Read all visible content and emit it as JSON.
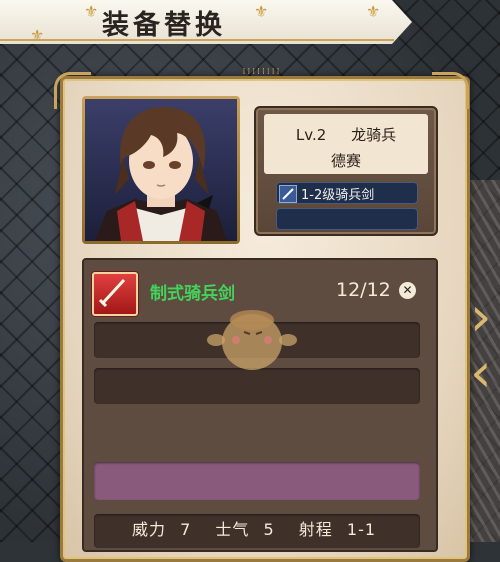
{
  "title": "装备替换",
  "unit": {
    "level": "Lv.2",
    "class": "龙骑兵",
    "name": "德赛",
    "equipped": [
      "1-2级骑兵剑",
      ""
    ]
  },
  "weapon": {
    "name": "制式骑兵剑",
    "uses": "12/12"
  },
  "stats": {
    "power_label": "威力",
    "power": "7",
    "morale_label": "士气",
    "morale": "5",
    "range_label": "射程",
    "range": "1-1"
  },
  "colors": {
    "weapon_name": "#43d35a",
    "panel": "#e6d6bf",
    "gold": "#c9a45a"
  },
  "icons": {
    "weapon": "sword-icon",
    "close": "close-icon",
    "next": "chevron-right-icon",
    "prev": "chevron-left-icon"
  }
}
